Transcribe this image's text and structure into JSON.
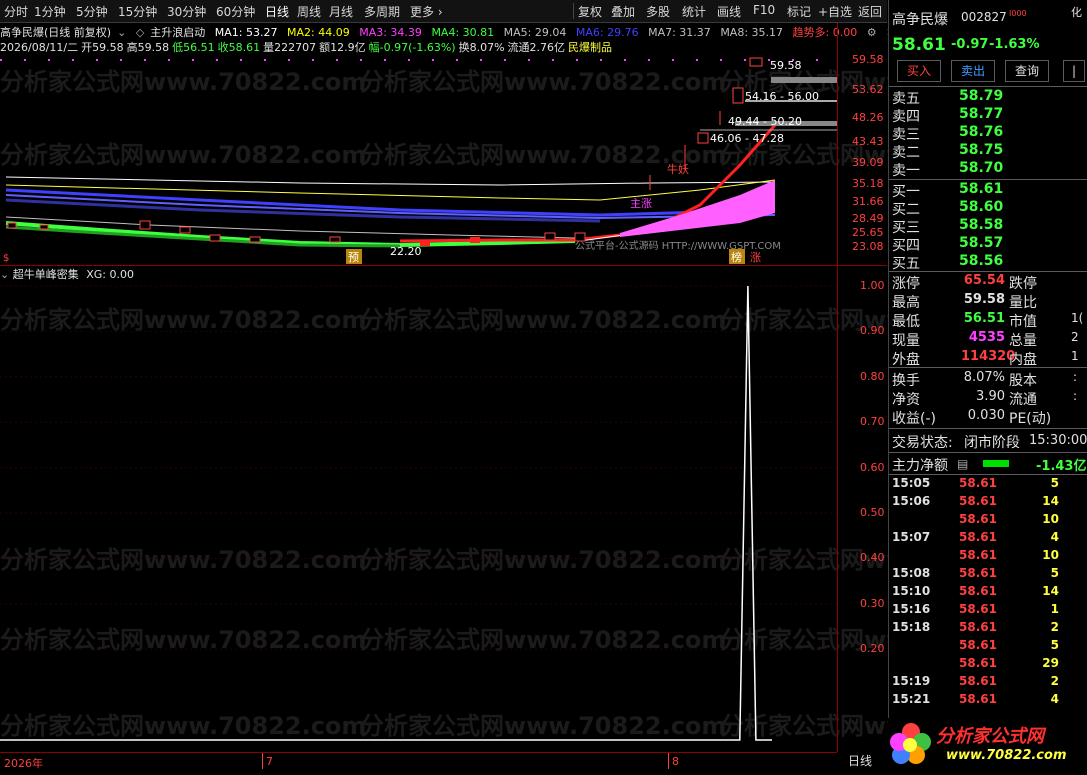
{
  "toolbar": {
    "periods": [
      "分时",
      "1分钟",
      "5分钟",
      "15分钟",
      "30分钟",
      "60分钟",
      "日线",
      "周线",
      "月线",
      "多周期",
      "更多"
    ],
    "active_period": "日线",
    "actions": [
      "复权",
      "叠加",
      "多股",
      "统计",
      "画线",
      "F10",
      "标记",
      "+自选",
      "返回"
    ]
  },
  "ma_line": {
    "title": "高争民爆(日线 前复权)",
    "indicator_name": "主升浪启动",
    "items": [
      {
        "label": "MA1: 53.27",
        "color": "#ffffff"
      },
      {
        "label": "MA2: 44.09",
        "color": "#ffff00"
      },
      {
        "label": "MA3: 34.39",
        "color": "#ff40ff"
      },
      {
        "label": "MA4: 30.81",
        "color": "#40ff40"
      },
      {
        "label": "MA5: 29.04",
        "color": "#c0c0c0"
      },
      {
        "label": "MA6: 29.76",
        "color": "#4040ff"
      },
      {
        "label": "MA7: 31.37",
        "color": "#c0c0c0"
      },
      {
        "label": "MA8: 35.17",
        "color": "#c0c0c0"
      },
      {
        "label": "趋势多: 0.00",
        "color": "#ff4040"
      }
    ]
  },
  "info_line": {
    "date": "2026/08/11/二",
    "open": "开59.58",
    "high": "高59.58",
    "low": "低56.51",
    "close": "收58.61",
    "volume": "量222707",
    "amount": "额12.9亿",
    "change": "幅-0.97(-1.63%)",
    "turnover": "换8.07%",
    "float": "流通2.76亿",
    "sector": "民爆制品"
  },
  "watermark": "分析家公式网www.70822.com",
  "main_chart": {
    "price_axis": [
      "59.58",
      "53.62",
      "48.26",
      "43.43",
      "39.09",
      "35.18",
      "31.66",
      "28.49",
      "25.65",
      "23.08"
    ],
    "annotations": {
      "high_label": "59.58",
      "level1": "54.16 - 56.00",
      "level2": "49.44 - 50.20",
      "level3": "46.06 - 47.28",
      "low_label": "22.20",
      "niu_yao": "牛妖",
      "zhu_zhang": "主涨",
      "source": "公式平台-公式源码 HTTP://WWW.GSPT.COM",
      "marker_yu": "预",
      "marker_bang": "榜",
      "marker_zhang": "涨",
      "marker_s": "$"
    }
  },
  "indicator": {
    "title": "超牛单峰密集",
    "value": "XG: 0.00",
    "axis": [
      "1.00",
      "0.90",
      "0.80",
      "0.70",
      "0.60",
      "0.50",
      "0.40",
      "0.30",
      "0.20"
    ],
    "chart_data": {
      "type": "line",
      "title": "超牛单峰密集",
      "series": [
        {
          "name": "XG",
          "values": [
            0,
            0,
            0,
            0,
            0,
            0,
            0,
            0,
            0,
            0,
            0,
            0,
            0,
            0,
            0,
            0,
            0,
            0,
            1,
            0,
            0,
            0
          ]
        }
      ],
      "ylim": [
        0,
        1.0
      ]
    }
  },
  "bottom_axis": {
    "year": "2026年",
    "m7": "7",
    "m8": "8",
    "period": "日线"
  },
  "right_panel": {
    "name": "高争民爆",
    "code": "002827",
    "sup": "I000",
    "price": "58.61",
    "change": "-0.97",
    "pct": "-1.63%",
    "side_label": "化",
    "buttons": [
      "买入",
      "卖出",
      "查询"
    ],
    "asks": [
      {
        "label": "卖五",
        "price": "58.79"
      },
      {
        "label": "卖四",
        "price": "58.77"
      },
      {
        "label": "卖三",
        "price": "58.76"
      },
      {
        "label": "卖二",
        "price": "58.75"
      },
      {
        "label": "卖一",
        "price": "58.70"
      }
    ],
    "bids": [
      {
        "label": "买一",
        "price": "58.61"
      },
      {
        "label": "买二",
        "price": "58.60"
      },
      {
        "label": "买三",
        "price": "58.58"
      },
      {
        "label": "买四",
        "price": "58.57"
      },
      {
        "label": "买五",
        "price": "58.56"
      }
    ],
    "stats": [
      {
        "k1": "涨停",
        "v1": "65.54",
        "c1": "#ff4040",
        "k2": "跌停",
        "v2": ""
      },
      {
        "k1": "最高",
        "v1": "59.58",
        "c1": "#e0e0e0",
        "k2": "量比",
        "v2": ""
      },
      {
        "k1": "最低",
        "v1": "56.51",
        "c1": "#40ff40",
        "k2": "市值",
        "v2": "1("
      },
      {
        "k1": "现量",
        "v1": "4535",
        "c1": "#ff40ff",
        "k2": "总量",
        "v2": "2"
      },
      {
        "k1": "外盘",
        "v1": "114320",
        "c1": "#ff4040",
        "k2": "内盘",
        "v2": "1"
      }
    ],
    "stats2": [
      {
        "k1": "换手",
        "v1": "8.07%",
        "k2": "股本",
        "v2": ":"
      },
      {
        "k1": "净资",
        "v1": "3.90",
        "k2": "流通",
        "v2": ":"
      },
      {
        "k1": "收益(-)",
        "v1": "0.030",
        "k2": "PE(动)",
        "v2": ""
      }
    ],
    "trade_status_label": "交易状态:",
    "trade_status": "闭市阶段",
    "trade_time": "15:30:00",
    "main_net_label": "主力净额",
    "main_net_value": "-1.43亿",
    "ticks": [
      {
        "t": "15:05",
        "p": "58.61",
        "v": "5"
      },
      {
        "t": "15:06",
        "p": "58.61",
        "v": "14"
      },
      {
        "t": "",
        "p": "58.61",
        "v": "10"
      },
      {
        "t": "15:07",
        "p": "58.61",
        "v": "4"
      },
      {
        "t": "",
        "p": "58.61",
        "v": "10"
      },
      {
        "t": "15:08",
        "p": "58.61",
        "v": "5"
      },
      {
        "t": "15:10",
        "p": "58.61",
        "v": "14"
      },
      {
        "t": "15:16",
        "p": "58.61",
        "v": "1"
      },
      {
        "t": "15:18",
        "p": "58.61",
        "v": "2"
      },
      {
        "t": "",
        "p": "58.61",
        "v": "5"
      },
      {
        "t": "",
        "p": "58.61",
        "v": "29"
      },
      {
        "t": "15:19",
        "p": "58.61",
        "v": "2"
      },
      {
        "t": "15:21",
        "p": "58.61",
        "v": "4"
      }
    ],
    "logo_text": "分析家公式网",
    "logo_url": "www.70822.com"
  }
}
